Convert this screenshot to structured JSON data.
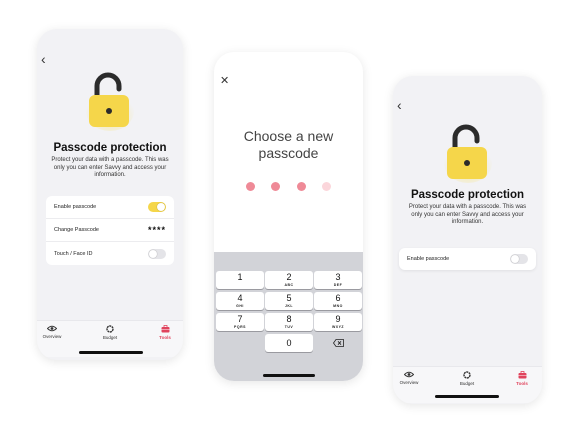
{
  "screen1": {
    "title": "Passcode protection",
    "description": "Protect your data with a passcode. This was only you can enter Savvy and access your information.",
    "settings": [
      {
        "label": "Enable passcode",
        "control": "toggle-on"
      },
      {
        "label": "Change Passcode",
        "control": "stars",
        "value": "****"
      },
      {
        "label": "Touch / Face ID",
        "control": "toggle-off"
      }
    ]
  },
  "screen2": {
    "heading": "Choose a new passcode",
    "filled_dots": 3,
    "total_dots": 4,
    "keys": [
      {
        "num": "1",
        "letters": ""
      },
      {
        "num": "2",
        "letters": "ABC"
      },
      {
        "num": "3",
        "letters": "DEF"
      },
      {
        "num": "4",
        "letters": "GHI"
      },
      {
        "num": "5",
        "letters": "JKL"
      },
      {
        "num": "6",
        "letters": "MNO"
      },
      {
        "num": "7",
        "letters": "PQRS"
      },
      {
        "num": "8",
        "letters": "TUV"
      },
      {
        "num": "9",
        "letters": "WXYZ"
      },
      {
        "num": "0",
        "letters": ""
      }
    ]
  },
  "screen3": {
    "title": "Passcode protection",
    "description": "Protect your data with a passcode. This was only you can enter Savvy and access your information.",
    "settings": [
      {
        "label": "Enable passcode",
        "control": "toggle-off"
      }
    ]
  },
  "tabs": [
    {
      "label": "Overview",
      "icon": "eye-icon"
    },
    {
      "label": "Budget",
      "icon": "budget-ring-icon"
    },
    {
      "label": "Tools",
      "icon": "toolbox-icon",
      "active": true
    }
  ],
  "colors": {
    "accent_yellow": "#f5d64a",
    "accent_pink": "#e0435d",
    "dot_filled": "#ef8a97",
    "dot_empty": "#fbd6db"
  }
}
